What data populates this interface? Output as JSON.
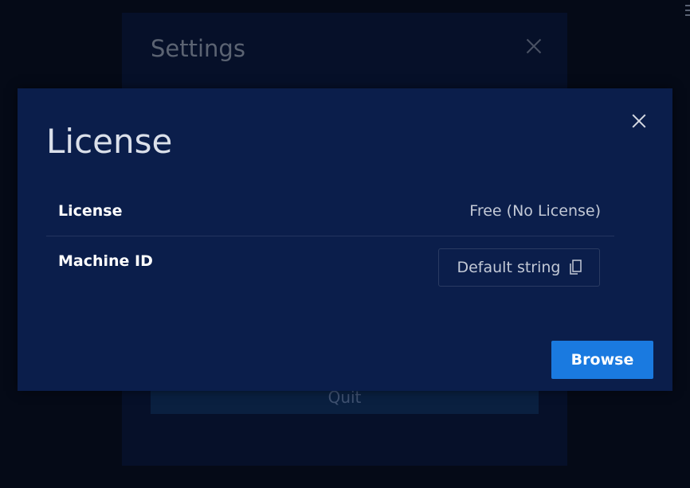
{
  "background_dialog": {
    "title": "Settings",
    "quit_label": "Quit"
  },
  "license_dialog": {
    "title": "License",
    "rows": [
      {
        "label": "License",
        "value": "Free (No License)"
      },
      {
        "label": "Machine ID",
        "value": "Default string"
      }
    ],
    "browse_label": "Browse",
    "icons": {
      "close": "close-icon",
      "copy": "copy-icon"
    }
  },
  "colors": {
    "primary_button": "#1a7ae0",
    "modal_background": "#0b1e4b",
    "page_background": "#050a17"
  }
}
